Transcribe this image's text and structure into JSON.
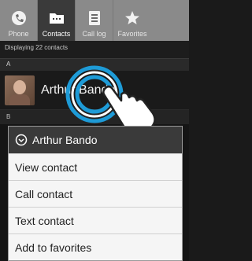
{
  "tabs": [
    {
      "label": "Phone",
      "icon": "phone-icon",
      "active": false
    },
    {
      "label": "Contacts",
      "icon": "folder-icon",
      "active": true
    },
    {
      "label": "Call log",
      "icon": "call-log-icon",
      "active": false
    },
    {
      "label": "Favorites",
      "icon": "star-icon",
      "active": false
    }
  ],
  "status": {
    "text": "Displaying 22 contacts"
  },
  "sections": {
    "a": "A",
    "b": "B"
  },
  "contact": {
    "name": "Arthur Bando"
  },
  "menu": {
    "title": "Arthur Bando",
    "items": [
      "View contact",
      "Call contact",
      "Text contact",
      "Add to favorites"
    ]
  },
  "colors": {
    "accent": "#1e9bd7",
    "tab_bg": "#8a8a8a",
    "tab_active": "#3a3a3a"
  }
}
